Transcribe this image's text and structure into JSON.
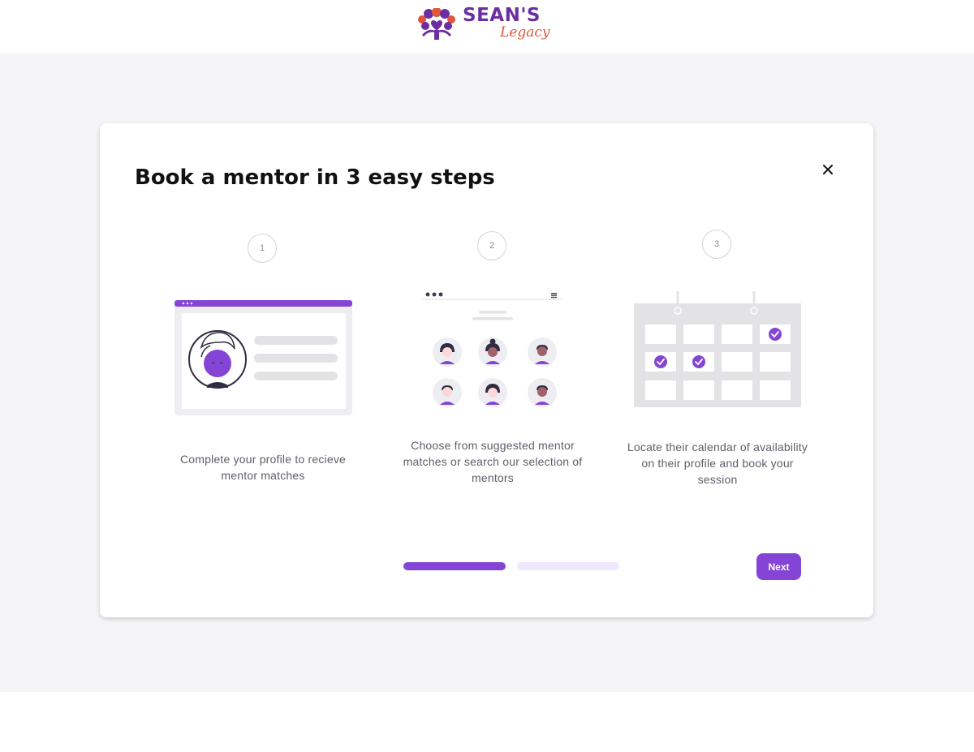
{
  "header": {
    "logo_primary": "SEAN'S",
    "logo_secondary": "Legacy"
  },
  "modal": {
    "title": "Book a mentor in 3 easy steps",
    "close_icon": "close-icon",
    "steps": [
      {
        "number": "1",
        "text": "Complete your profile to recieve mentor matches",
        "illustration": "profile-card-illustration"
      },
      {
        "number": "2",
        "text": "Choose from suggested mentor matches or search our selection of mentors",
        "illustration": "mentor-grid-illustration"
      },
      {
        "number": "3",
        "text": "Locate their calendar of availability on their profile and book your session",
        "illustration": "calendar-illustration"
      }
    ],
    "progress": {
      "current_step": 1,
      "total_steps": 2
    },
    "next_label": "Next"
  },
  "colors": {
    "brand_purple": "#8445d6",
    "logo_purple": "#6b2fa3",
    "logo_orange": "#e0563a",
    "progress_inactive": "#efe7fb",
    "backdrop": "#f5f5f7"
  }
}
